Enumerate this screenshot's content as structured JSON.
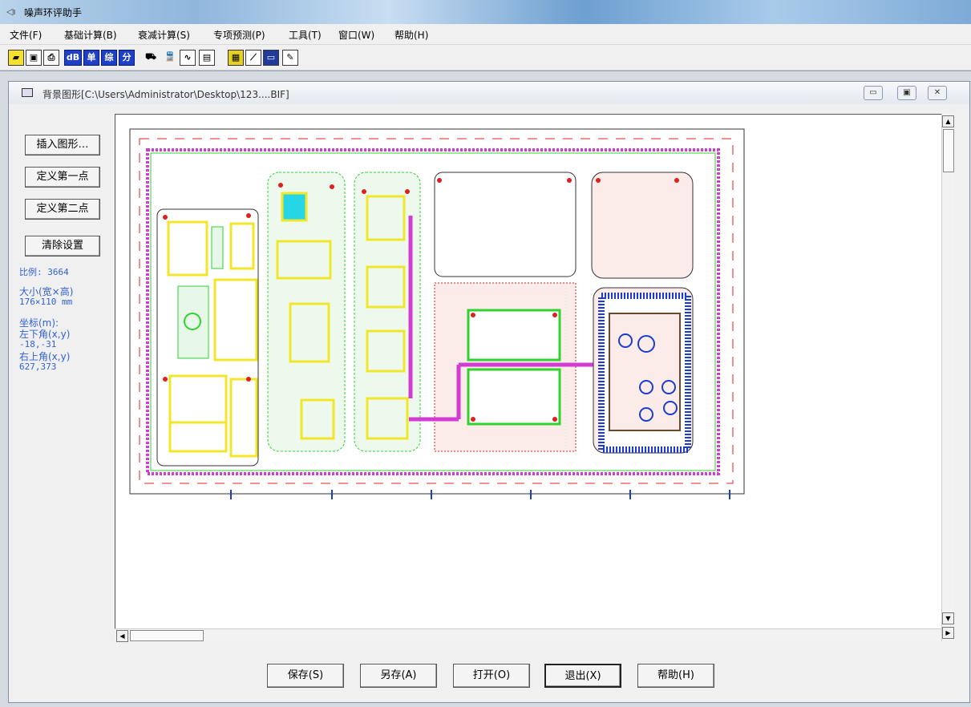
{
  "app": {
    "title": "噪声环评助手",
    "icon": "speaker-icon"
  },
  "menu": [
    "文件(F)",
    "基础计算(B)",
    "衰减计算(S)",
    "专项预测(P)",
    "工具(T)",
    "窗口(W)",
    "帮助(H)"
  ],
  "toolbar": {
    "icons": [
      "open-folder-icon",
      "save-icon",
      "print-icon",
      "db-icon",
      "single-icon",
      "composite-icon",
      "split-icon",
      "vehicle-icon",
      "train-icon",
      "wave-icon",
      "calculator-icon",
      "grid-icon",
      "chart-icon",
      "window-icon",
      "edit-icon"
    ],
    "labels": {
      "db": "dB",
      "single": "单",
      "composite": "综",
      "split": "分"
    }
  },
  "child": {
    "caption": "背景图形[C:\\Users\\Administrator\\Desktop\\123....BIF]",
    "buttons": [
      "minimize-icon",
      "restore-icon",
      "close-icon"
    ]
  },
  "sidebar": {
    "buttons": {
      "insert": "插入图形…",
      "point1": "定义第一点",
      "point2": "定义第二点",
      "clear": "清除设置"
    },
    "scale": "比例: 3664",
    "size_label": "大小(宽×高)",
    "size_value": "176×110 mm",
    "coord_label": "坐标(m):",
    "lower_left_label": "左下角(x,y)",
    "lower_left_value": "-18,-31",
    "upper_right_label": "右上角(x,y)",
    "upper_right_value": "627,373"
  },
  "buttons": {
    "save": "保存(S)",
    "save_as": "另存(A)",
    "open": "打开(O)",
    "exit": "退出(X)",
    "help": "帮助(H)"
  },
  "colors": {
    "accent_text": "#3060d8",
    "plan_yellow": "#f2e62a",
    "plan_green": "#2fd22f",
    "plan_magenta": "#d23cd2",
    "plan_red": "#e02020",
    "plan_blue": "#1a3cd0"
  }
}
